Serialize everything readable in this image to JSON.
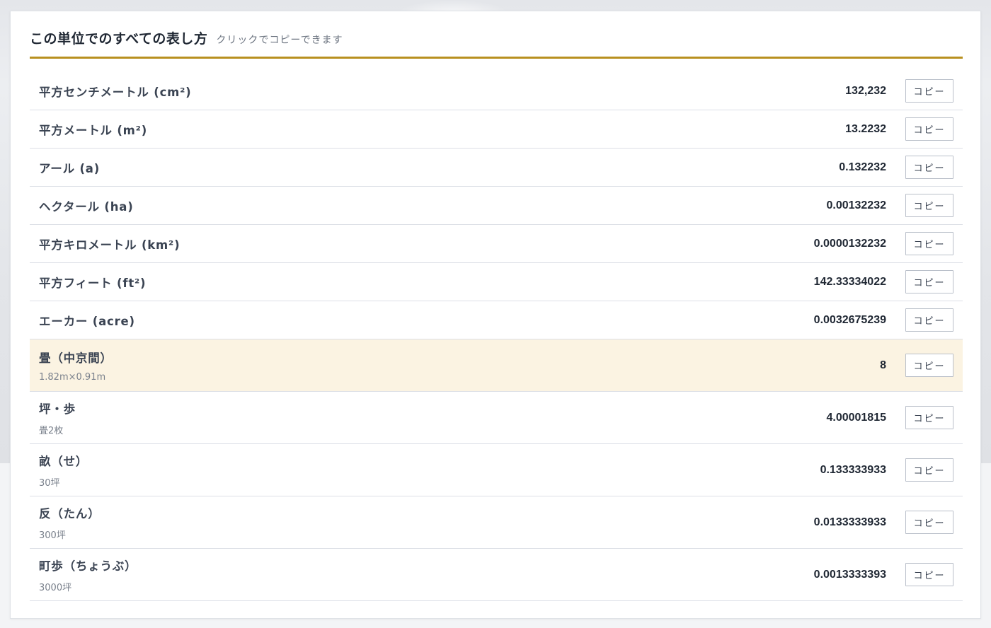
{
  "header": {
    "title": "この単位でのすべての表し方",
    "hint": "クリックでコピーできます"
  },
  "rows": [
    {
      "name": "平方センチメートル (cm²)",
      "sub": "",
      "value": "132,232",
      "button": "コピー"
    },
    {
      "name": "平方メートル (m²)",
      "sub": "",
      "value": "13.2232",
      "button": "コピー"
    },
    {
      "name": "アール (a)",
      "sub": "",
      "value": "0.132232",
      "button": "コピー"
    },
    {
      "name": "ヘクタール (ha)",
      "sub": "",
      "value": "0.00132232",
      "button": "コピー"
    },
    {
      "name": "平方キロメートル (km²)",
      "sub": "",
      "value": "0.0000132232",
      "button": "コピー"
    },
    {
      "name": "平方フィート (ft²)",
      "sub": "",
      "value": "142.33334022",
      "button": "コピー"
    },
    {
      "name": "エーカー (acre)",
      "sub": "",
      "value": "0.0032675239",
      "button": "コピー"
    },
    {
      "name": "畳（中京間）",
      "sub": "1.82m×0.91m",
      "value": "8",
      "button": "コピー",
      "highlight": true
    },
    {
      "name": "坪・歩",
      "sub": "畳2枚",
      "value": "4.00001815",
      "button": "コピー"
    },
    {
      "name": "畝（せ）",
      "sub": "30坪",
      "value": "0.133333933",
      "button": "コピー"
    },
    {
      "name": "反（たん）",
      "sub": "300坪",
      "value": "0.0133333933",
      "button": "コピー"
    },
    {
      "name": "町歩（ちょうぶ）",
      "sub": "3000坪",
      "value": "0.0013333393",
      "button": "コピー"
    }
  ],
  "colors": {
    "accent": "#b8901f",
    "highlight_row": "#fbf3e2"
  }
}
